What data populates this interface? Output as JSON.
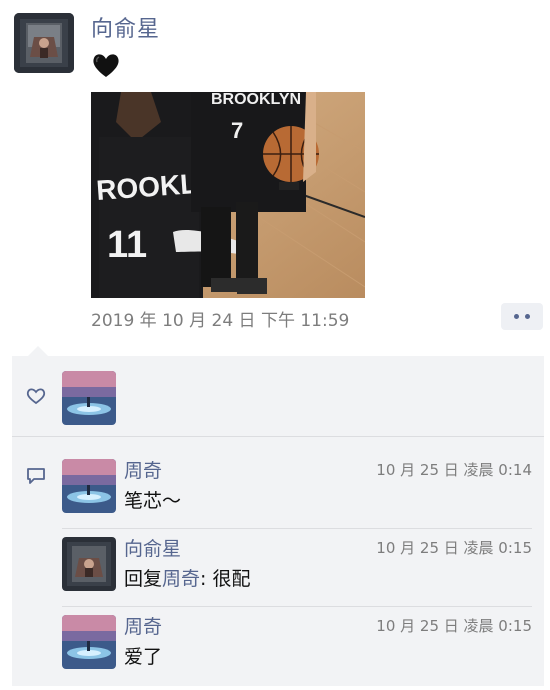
{
  "post": {
    "author": "向俞星",
    "text": "🖤",
    "time": "2019 年 10 月 24 日  下午 11:59"
  },
  "likes": {
    "icon": "heart-outline-icon",
    "users": [
      "like-avatar"
    ]
  },
  "comments": [
    {
      "name": "周奇",
      "time": "10 月 25 日  凌晨 0:14",
      "text": "笔芯～"
    },
    {
      "name": "向俞星",
      "time": "10 月 25 日  凌晨 0:15",
      "reply_prefix": "回复",
      "reply_to": "周奇",
      "reply_text": ": 很配"
    },
    {
      "name": "周奇",
      "time": "10 月 25 日  凌晨 0:15",
      "text": "爱了"
    }
  ],
  "colors": {
    "link": "#56668f",
    "meta": "#7d7d7d",
    "panel": "#f2f3f5"
  }
}
